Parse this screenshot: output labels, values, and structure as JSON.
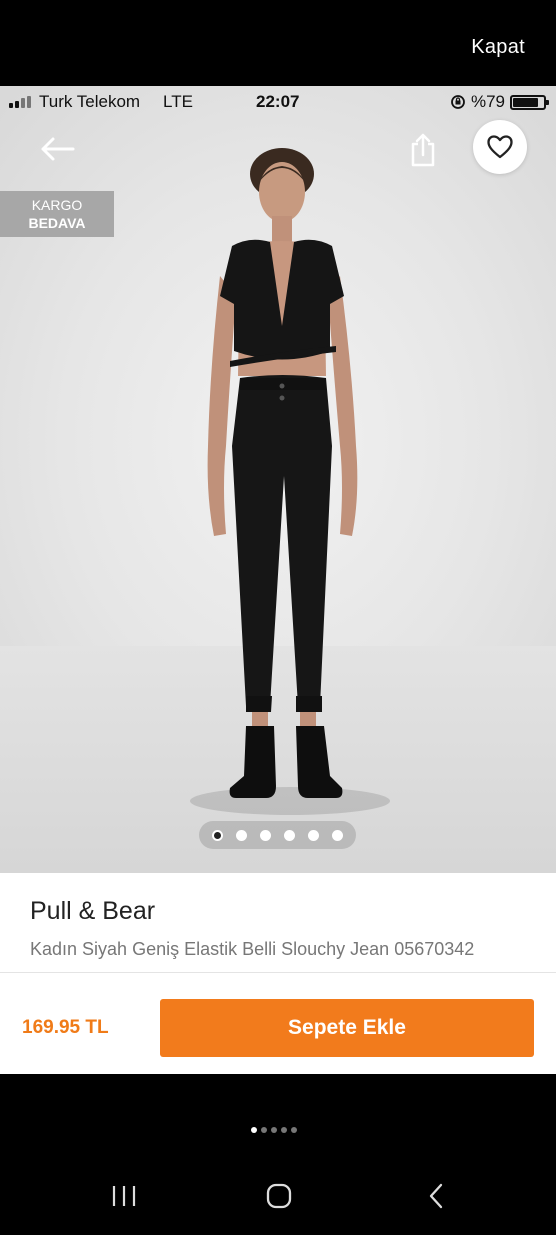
{
  "outer": {
    "close_label": "Kapat"
  },
  "status_bar": {
    "carrier": "Turk Telekom",
    "network": "LTE",
    "time": "22:07",
    "battery": "%79",
    "battery_level": 0.79
  },
  "product_view": {
    "back_icon": "arrow-left-icon",
    "share_icon": "share-icon",
    "favorite_icon": "heart-icon",
    "badge": {
      "line1": "KARGO",
      "line2": "BEDAVA"
    },
    "image_count": 6,
    "active_image": 0
  },
  "product": {
    "brand": "Pull & Bear",
    "name": "Kadın Siyah Geniş Elastik Belli Slouchy Jean 05670342",
    "price": "169.95 TL",
    "add_to_cart_label": "Sepete Ekle"
  },
  "system": {
    "page_count": 5,
    "active_page": 0,
    "nav": [
      "recents-icon",
      "home-icon",
      "back-icon"
    ]
  },
  "colors": {
    "accent": "#f27b1c",
    "price": "#f07b18",
    "badge": "#a7a7a7"
  }
}
